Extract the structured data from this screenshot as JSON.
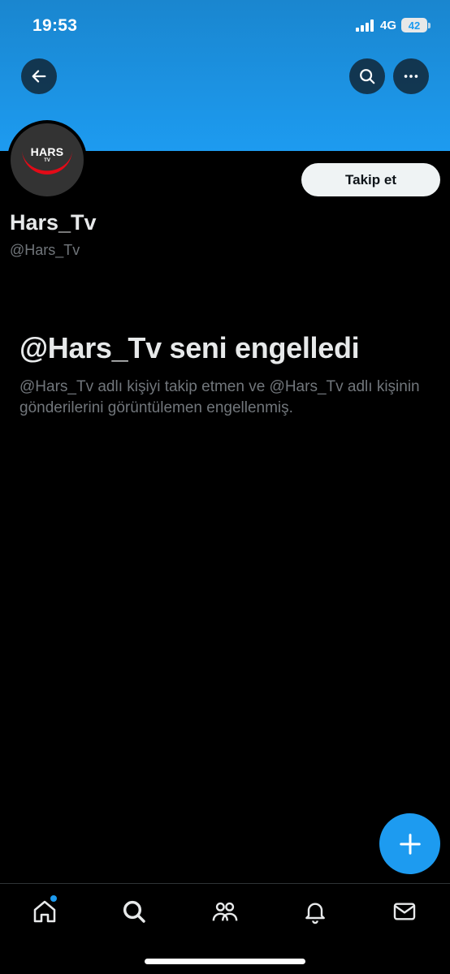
{
  "status_bar": {
    "time": "19:53",
    "network": "4G",
    "battery": "42",
    "signal_bars_filled": 4
  },
  "header": {
    "back_icon": "arrow-left-icon",
    "search_icon": "search-icon",
    "more_icon": "more-horizontal-icon",
    "banner_color": "#1d9bf0"
  },
  "profile": {
    "avatar_logo_text": "HARS",
    "avatar_logo_sub": "TV",
    "display_name": "Hars_Tv",
    "handle": "@Hars_Tv",
    "follow_label": "Takip et"
  },
  "blocked": {
    "title": "@Hars_Tv seni engelledi",
    "description": "@Hars_Tv adlı kişiyi takip etmen ve @Hars_Tv adlı kişinin gönderilerini görüntülemen engellenmiş."
  },
  "fab": {
    "icon": "plus-icon"
  },
  "tab_bar": {
    "tabs": [
      {
        "name": "home",
        "icon": "home-icon",
        "has_notification_dot": true
      },
      {
        "name": "search",
        "icon": "search-icon"
      },
      {
        "name": "communities",
        "icon": "people-icon"
      },
      {
        "name": "notifications",
        "icon": "bell-icon"
      },
      {
        "name": "messages",
        "icon": "mail-icon"
      }
    ]
  },
  "colors": {
    "accent": "#1d9bf0",
    "background": "#000000",
    "primary_text": "#e7e9ea",
    "secondary_text": "#71767b"
  }
}
